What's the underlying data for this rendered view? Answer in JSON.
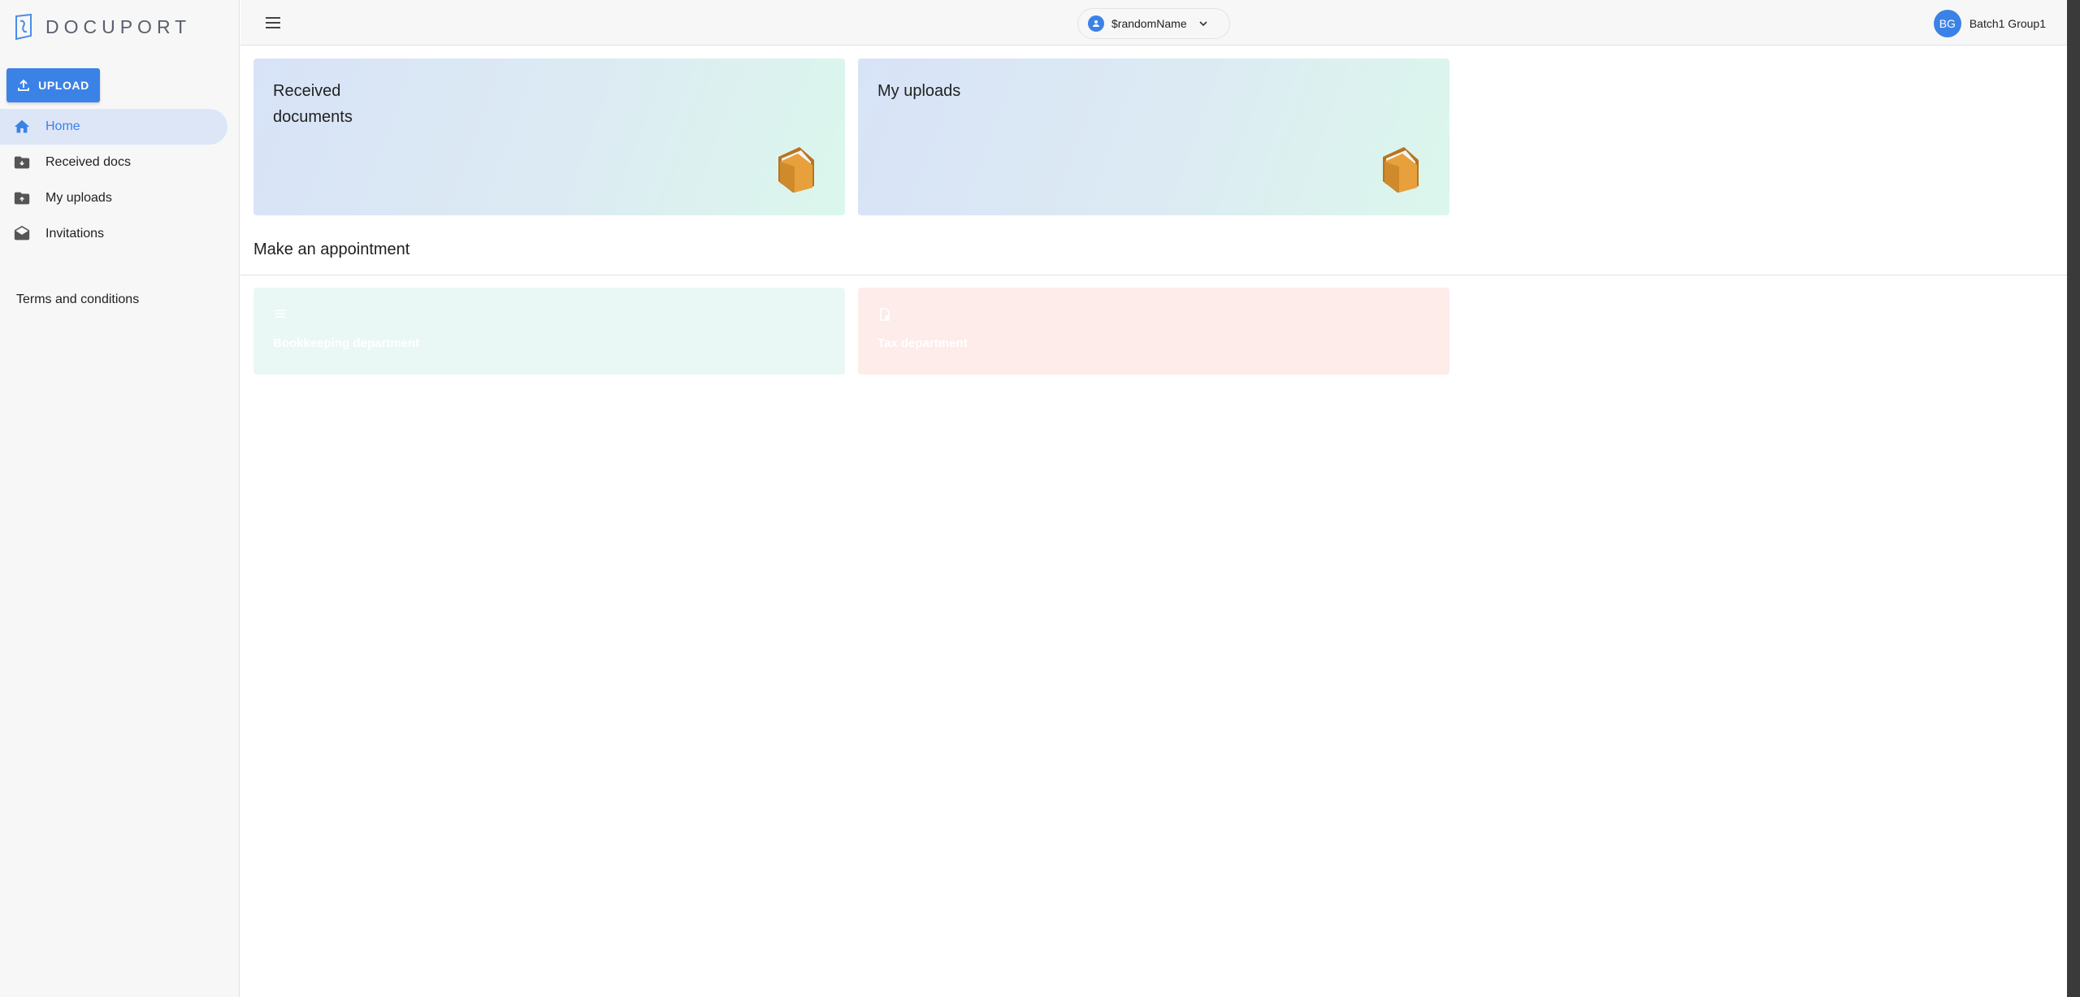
{
  "app": {
    "logo_text": "DOCUPORT"
  },
  "sidebar": {
    "upload_label": "UPLOAD",
    "items": [
      {
        "label": "Home",
        "icon": "home-icon",
        "active": true
      },
      {
        "label": "Received docs",
        "icon": "folder-download-icon",
        "active": false
      },
      {
        "label": "My uploads",
        "icon": "folder-upload-icon",
        "active": false
      },
      {
        "label": "Invitations",
        "icon": "envelope-open-icon",
        "active": false
      }
    ],
    "terms_label": "Terms and conditions"
  },
  "topbar": {
    "account_name": "$randomName",
    "user_initials": "BG",
    "user_name": "Batch1 Group1"
  },
  "main": {
    "cards": [
      {
        "title": "Received documents",
        "icon": "folder-icon"
      },
      {
        "title": "My uploads",
        "icon": "folder-icon"
      }
    ],
    "appointment_title": "Make an appointment",
    "departments": [
      {
        "label": "Bookkeeping department",
        "icon": "list-icon"
      },
      {
        "label": "Tax department",
        "icon": "document-icon"
      }
    ]
  },
  "colors": {
    "accent": "#3b82e6",
    "sidebar_bg": "#f7f7f7",
    "active_item_bg": "#dde6f7",
    "bookkeeping_bg": "#eaf8f5",
    "tax_bg": "#fdecea"
  }
}
